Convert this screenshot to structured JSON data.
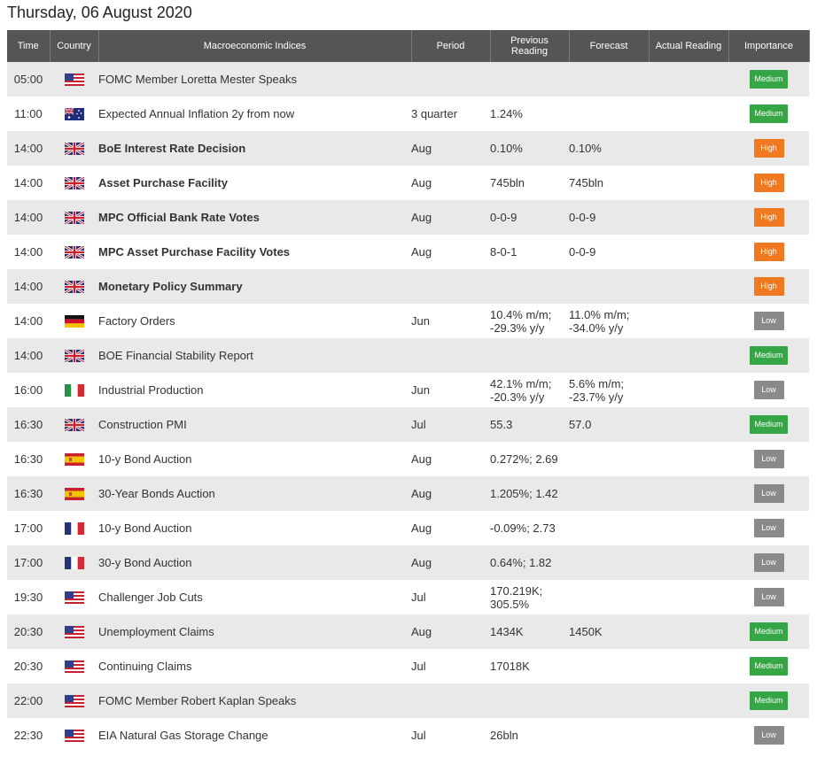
{
  "date_title": "Thursday, 06 August 2020",
  "columns": [
    "Time",
    "Country",
    "Macroeconomic Indices",
    "Period",
    "Previous Reading",
    "Forecast",
    "Actual Reading",
    "Importance"
  ],
  "colors": {
    "header_bg": "#555555",
    "medium": "#35a545",
    "high": "#f07820",
    "low": "#8a8a8a"
  },
  "events": [
    {
      "time": "05:00",
      "country": "us-flag",
      "name": "FOMC Member Loretta Mester Speaks",
      "bold": false,
      "period": "",
      "prev": "",
      "forecast": "",
      "actual": "",
      "importance": "Medium"
    },
    {
      "time": "11:00",
      "country": "au-flag",
      "name": "Expected Annual Inflation 2y from now",
      "bold": false,
      "period": "3 quarter",
      "prev": "1.24%",
      "forecast": "",
      "actual": "",
      "importance": "Medium"
    },
    {
      "time": "14:00",
      "country": "uk-flag",
      "name": "BoE Interest Rate Decision",
      "bold": true,
      "period": "Aug",
      "prev": "0.10%",
      "forecast": "0.10%",
      "actual": "",
      "importance": "High"
    },
    {
      "time": "14:00",
      "country": "uk-flag",
      "name": "Asset Purchase Facility",
      "bold": true,
      "period": "Aug",
      "prev": "745bln",
      "forecast": "745bln",
      "actual": "",
      "importance": "High"
    },
    {
      "time": "14:00",
      "country": "uk-flag",
      "name": "MPC Official Bank Rate Votes",
      "bold": true,
      "period": "Aug",
      "prev": "0-0-9",
      "forecast": "0-0-9",
      "actual": "",
      "importance": "High"
    },
    {
      "time": "14:00",
      "country": "uk-flag",
      "name": "MPC Asset Purchase Facility Votes",
      "bold": true,
      "period": "Aug",
      "prev": "8-0-1",
      "forecast": "0-0-9",
      "actual": "",
      "importance": "High"
    },
    {
      "time": "14:00",
      "country": "uk-flag",
      "name": "Monetary Policy Summary",
      "bold": true,
      "period": "",
      "prev": "",
      "forecast": "",
      "actual": "",
      "importance": "High"
    },
    {
      "time": "14:00",
      "country": "de-flag",
      "name": "Factory Orders",
      "bold": false,
      "period": "Jun",
      "prev": "10.4% m/m; -29.3% y/y",
      "forecast": "11.0% m/m; -34.0% y/y",
      "actual": "",
      "importance": "Low"
    },
    {
      "time": "14:00",
      "country": "uk-flag",
      "name": "BOE Financial Stability Report",
      "bold": false,
      "period": "",
      "prev": "",
      "forecast": "",
      "actual": "",
      "importance": "Medium"
    },
    {
      "time": "16:00",
      "country": "it-flag",
      "name": "Industrial Production",
      "bold": false,
      "period": "Jun",
      "prev": "42.1% m/m; -20.3% y/y",
      "forecast": "5.6% m/m; -23.7% y/y",
      "actual": "",
      "importance": "Low"
    },
    {
      "time": "16:30",
      "country": "uk-flag",
      "name": "Construction PMI",
      "bold": false,
      "period": "Jul",
      "prev": "55.3",
      "forecast": "57.0",
      "actual": "",
      "importance": "Medium"
    },
    {
      "time": "16:30",
      "country": "es-flag",
      "name": "10-y Bond Auction",
      "bold": false,
      "period": "Aug",
      "prev": "0.272%; 2.69",
      "forecast": "",
      "actual": "",
      "importance": "Low"
    },
    {
      "time": "16:30",
      "country": "es-flag",
      "name": "30-Year Bonds Auction",
      "bold": false,
      "period": "Aug",
      "prev": "1.205%; 1.42",
      "forecast": "",
      "actual": "",
      "importance": "Low"
    },
    {
      "time": "17:00",
      "country": "fr-flag",
      "name": "10-y Bond Auction",
      "bold": false,
      "period": "Aug",
      "prev": "-0.09%; 2.73",
      "forecast": "",
      "actual": "",
      "importance": "Low"
    },
    {
      "time": "17:00",
      "country": "fr-flag",
      "name": "30-y Bond Auction",
      "bold": false,
      "period": "Aug",
      "prev": "0.64%; 1.82",
      "forecast": "",
      "actual": "",
      "importance": "Low"
    },
    {
      "time": "19:30",
      "country": "us-flag",
      "name": "Challenger Job Cuts",
      "bold": false,
      "period": "Jul",
      "prev": "170.219K; 305.5%",
      "forecast": "",
      "actual": "",
      "importance": "Low"
    },
    {
      "time": "20:30",
      "country": "us-flag",
      "name": "Unemployment Claims",
      "bold": false,
      "period": "Aug",
      "prev": "1434K",
      "forecast": "1450K",
      "actual": "",
      "importance": "Medium"
    },
    {
      "time": "20:30",
      "country": "us-flag",
      "name": "Continuing Claims",
      "bold": false,
      "period": "Jul",
      "prev": "17018K",
      "forecast": "",
      "actual": "",
      "importance": "Medium"
    },
    {
      "time": "22:00",
      "country": "us-flag",
      "name": "FOMC Member Robert Kaplan Speaks",
      "bold": false,
      "period": "",
      "prev": "",
      "forecast": "",
      "actual": "",
      "importance": "Medium"
    },
    {
      "time": "22:30",
      "country": "us-flag",
      "name": "EIA Natural Gas Storage Change",
      "bold": false,
      "period": "Jul",
      "prev": "26bln",
      "forecast": "",
      "actual": "",
      "importance": "Low"
    }
  ]
}
